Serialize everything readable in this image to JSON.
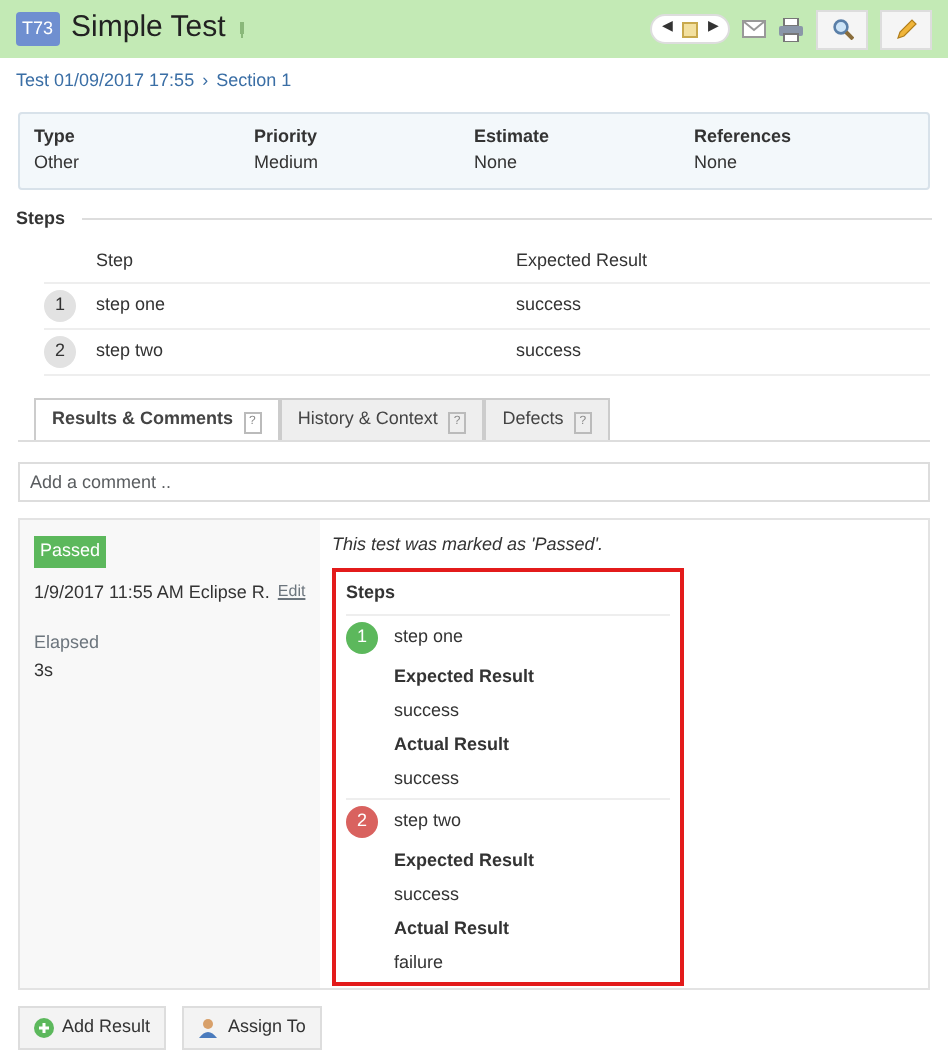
{
  "header": {
    "id_badge": "T73",
    "title": "Simple Test",
    "nav_prev": "◀",
    "nav_next": "▶"
  },
  "breadcrumb": [
    {
      "label": "Test 01/09/2017 17:55"
    },
    {
      "label": "Section 1"
    }
  ],
  "breadcrumb_sep": "›",
  "fields": [
    {
      "label": "Type",
      "value": "Other"
    },
    {
      "label": "Priority",
      "value": "Medium"
    },
    {
      "label": "Estimate",
      "value": "None"
    },
    {
      "label": "References",
      "value": "None"
    }
  ],
  "steps": {
    "title": "Steps",
    "columns": [
      "Step",
      "Expected Result"
    ],
    "rows": [
      {
        "number": "1",
        "step": "step one",
        "expected": "success"
      },
      {
        "number": "2",
        "step": "step two",
        "expected": "success"
      }
    ]
  },
  "tabs": [
    {
      "label": "Results & Comments",
      "help": "?",
      "selected": true
    },
    {
      "label": "History & Context",
      "help": "?",
      "selected": false
    },
    {
      "label": "Defects",
      "help": "?",
      "selected": false
    }
  ],
  "comment": {
    "placeholder": "Add a comment .."
  },
  "result": {
    "status": "Passed",
    "passed": true,
    "meta": "1/9/2017 11:55 AM Eclipse R.",
    "edit": "Edit",
    "elapsed_label": "Elapsed",
    "elapsed": "3s",
    "message": "This test was marked as 'Passed'.",
    "steps_title": "Steps",
    "steps": [
      {
        "number": "1",
        "color": "#5cb85c",
        "step": "step one",
        "expected_label": "Expected Result",
        "expected": "success",
        "actual_label": "Actual Result",
        "actual": "success"
      },
      {
        "number": "2",
        "color": "#d9625f",
        "step": "step two",
        "expected_label": "Expected Result",
        "expected": "success",
        "actual_label": "Actual Result",
        "actual": "failure"
      }
    ]
  },
  "buttons": [
    {
      "kind": "add",
      "label": "Add Result"
    },
    {
      "kind": "assign",
      "label": "Assign To"
    }
  ]
}
